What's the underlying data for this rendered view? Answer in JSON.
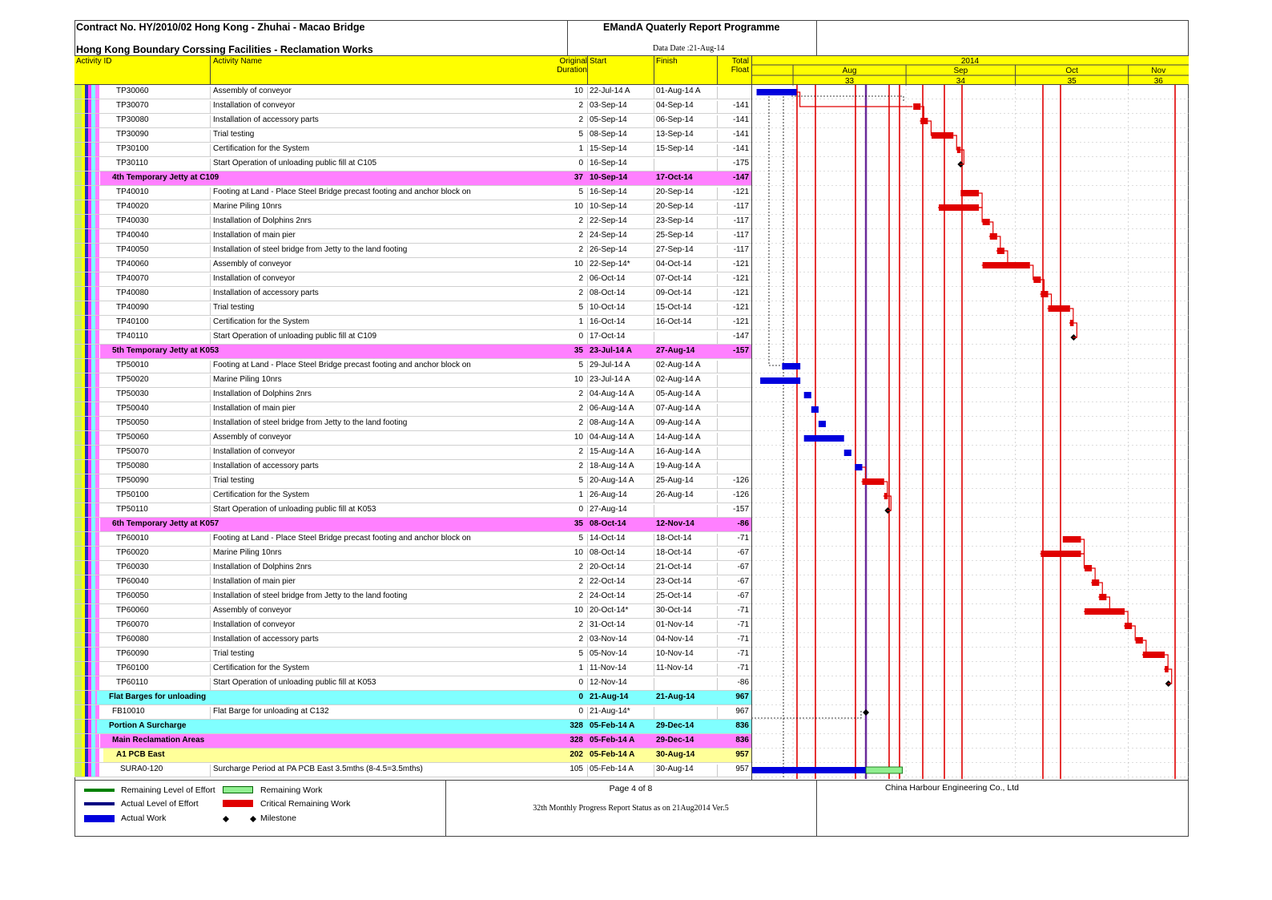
{
  "header": {
    "contract": "Contract No. HY/2010/02 Hong Kong - Zhuhai - Macao Bridge",
    "subtitle": "Hong Kong Boundary Corssing Facilities - Reclamation Works",
    "report_title": "EMandA Quaterly Report Programme",
    "data_date": "Data Date :21-Aug-14"
  },
  "columns": {
    "activity_id": "Activity ID",
    "activity_name": "Activity Name",
    "duration_1": "Original",
    "duration_2": "Duration",
    "start": "Start",
    "finish": "Finish",
    "float_1": "Total",
    "float_2": "Float"
  },
  "timescale": {
    "year": "2014",
    "months": [
      {
        "label": "Aug",
        "week": "33"
      },
      {
        "label": "Sep",
        "week": "34"
      },
      {
        "label": "Oct",
        "week": "35"
      },
      {
        "label": "Nov",
        "week": "36"
      }
    ]
  },
  "footer": {
    "page": "Page 4 of 8",
    "status": "32th Monthly Progress Report Status as on 21Aug2014 Ver.5",
    "company": "China Harbour Engineering Co., Ltd"
  },
  "legend": {
    "remaining_loe": "Remaining Level of Effort",
    "actual_loe": "Actual Level of Effort",
    "actual_work": "Actual Work",
    "remaining_work": "Remaining Work",
    "critical_remaining": "Critical Remaining Work",
    "milestone": "Milestone"
  },
  "colors": {
    "header_yellow": "#ffff00",
    "group_pink": "#ff80ff",
    "group_cyan": "#80ffff",
    "group_lightyellow": "#ffff99",
    "actual": "#0000dd",
    "critical": "#e00000",
    "remaining": "#90ee90",
    "loe_green": "#008000",
    "loe_navy": "#000080"
  },
  "chart_data": {
    "type": "gantt",
    "data_date": "21-Aug-14",
    "rows": [
      {
        "id": "TP30060",
        "name": "Assembly of conveyor",
        "dur": "10",
        "start": "22-Jul-14 A",
        "finish": "01-Aug-14 A",
        "float": "",
        "bar": "actual",
        "s": "2014-07-22",
        "f": "2014-08-01"
      },
      {
        "id": "TP30070",
        "name": "Installation of conveyor",
        "dur": "2",
        "start": "03-Sep-14",
        "finish": "04-Sep-14",
        "float": "-141",
        "bar": "critical",
        "s": "2014-09-03",
        "f": "2014-09-04"
      },
      {
        "id": "TP30080",
        "name": "Installation of accessory parts",
        "dur": "2",
        "start": "05-Sep-14",
        "finish": "06-Sep-14",
        "float": "-141",
        "bar": "critical",
        "s": "2014-09-05",
        "f": "2014-09-06"
      },
      {
        "id": "TP30090",
        "name": "Trial testing",
        "dur": "5",
        "start": "08-Sep-14",
        "finish": "13-Sep-14",
        "float": "-141",
        "bar": "critical",
        "s": "2014-09-08",
        "f": "2014-09-13"
      },
      {
        "id": "TP30100",
        "name": "Certification for the System",
        "dur": "1",
        "start": "15-Sep-14",
        "finish": "15-Sep-14",
        "float": "-141",
        "bar": "critical",
        "s": "2014-09-15",
        "f": "2014-09-15"
      },
      {
        "id": "TP30110",
        "name": "Start Operation of unloading public fill at C105",
        "dur": "0",
        "start": "16-Sep-14",
        "finish": "",
        "float": "-175",
        "bar": "milestone",
        "s": "2014-09-16",
        "f": "2014-09-16"
      },
      {
        "group": "pink",
        "name": "4th Temporary Jetty at C109",
        "dur": "37",
        "start": "10-Sep-14",
        "finish": "17-Oct-14",
        "float": "-147"
      },
      {
        "id": "TP40010",
        "name": "Footing at Land - Place Steel Bridge precast footing and anchor block on",
        "dur": "5",
        "start": "16-Sep-14",
        "finish": "20-Sep-14",
        "float": "-121",
        "bar": "critical",
        "s": "2014-09-16",
        "f": "2014-09-20"
      },
      {
        "id": "TP40020",
        "name": "Marine Piling 10nrs",
        "dur": "10",
        "start": "10-Sep-14",
        "finish": "20-Sep-14",
        "float": "-117",
        "bar": "critical",
        "s": "2014-09-10",
        "f": "2014-09-20"
      },
      {
        "id": "TP40030",
        "name": "Installation of Dolphins 2nrs",
        "dur": "2",
        "start": "22-Sep-14",
        "finish": "23-Sep-14",
        "float": "-117",
        "bar": "critical",
        "s": "2014-09-22",
        "f": "2014-09-23"
      },
      {
        "id": "TP40040",
        "name": "Installation of main pier",
        "dur": "2",
        "start": "24-Sep-14",
        "finish": "25-Sep-14",
        "float": "-117",
        "bar": "critical",
        "s": "2014-09-24",
        "f": "2014-09-25"
      },
      {
        "id": "TP40050",
        "name": "Installation of steel bridge from Jetty to the land footing",
        "dur": "2",
        "start": "26-Sep-14",
        "finish": "27-Sep-14",
        "float": "-117",
        "bar": "critical",
        "s": "2014-09-26",
        "f": "2014-09-27"
      },
      {
        "id": "TP40060",
        "name": "Assembly of conveyor",
        "dur": "10",
        "start": "22-Sep-14*",
        "finish": "04-Oct-14",
        "float": "-121",
        "bar": "critical",
        "s": "2014-09-22",
        "f": "2014-10-04"
      },
      {
        "id": "TP40070",
        "name": "Installation of conveyor",
        "dur": "2",
        "start": "06-Oct-14",
        "finish": "07-Oct-14",
        "float": "-121",
        "bar": "critical",
        "s": "2014-10-06",
        "f": "2014-10-07"
      },
      {
        "id": "TP40080",
        "name": "Installation of accessory parts",
        "dur": "2",
        "start": "08-Oct-14",
        "finish": "09-Oct-14",
        "float": "-121",
        "bar": "critical",
        "s": "2014-10-08",
        "f": "2014-10-09"
      },
      {
        "id": "TP40090",
        "name": "Trial testing",
        "dur": "5",
        "start": "10-Oct-14",
        "finish": "15-Oct-14",
        "float": "-121",
        "bar": "critical",
        "s": "2014-10-10",
        "f": "2014-10-15"
      },
      {
        "id": "TP40100",
        "name": "Certification for the System",
        "dur": "1",
        "start": "16-Oct-14",
        "finish": "16-Oct-14",
        "float": "-121",
        "bar": "critical",
        "s": "2014-10-16",
        "f": "2014-10-16"
      },
      {
        "id": "TP40110",
        "name": "Start Operation of unloading public fill at C109",
        "dur": "0",
        "start": "17-Oct-14",
        "finish": "",
        "float": "-147",
        "bar": "milestone",
        "s": "2014-10-17",
        "f": "2014-10-17"
      },
      {
        "group": "pink",
        "name": "5th Temporary Jetty at K053",
        "dur": "35",
        "start": "23-Jul-14 A",
        "finish": "27-Aug-14",
        "float": "-157"
      },
      {
        "id": "TP50010",
        "name": "Footing at Land - Place Steel Bridge precast footing and anchor block on",
        "dur": "5",
        "start": "29-Jul-14 A",
        "finish": "02-Aug-14 A",
        "float": "",
        "bar": "actual",
        "s": "2014-07-29",
        "f": "2014-08-02"
      },
      {
        "id": "TP50020",
        "name": "Marine Piling 10nrs",
        "dur": "10",
        "start": "23-Jul-14 A",
        "finish": "02-Aug-14 A",
        "float": "",
        "bar": "actual",
        "s": "2014-07-23",
        "f": "2014-08-02"
      },
      {
        "id": "TP50030",
        "name": "Installation of Dolphins 2nrs",
        "dur": "2",
        "start": "04-Aug-14 A",
        "finish": "05-Aug-14 A",
        "float": "",
        "bar": "actual",
        "s": "2014-08-04",
        "f": "2014-08-05"
      },
      {
        "id": "TP50040",
        "name": "Installation of main pier",
        "dur": "2",
        "start": "06-Aug-14 A",
        "finish": "07-Aug-14 A",
        "float": "",
        "bar": "actual",
        "s": "2014-08-06",
        "f": "2014-08-07"
      },
      {
        "id": "TP50050",
        "name": "Installation of steel bridge from Jetty to the land footing",
        "dur": "2",
        "start": "08-Aug-14 A",
        "finish": "09-Aug-14 A",
        "float": "",
        "bar": "actual",
        "s": "2014-08-08",
        "f": "2014-08-09"
      },
      {
        "id": "TP50060",
        "name": "Assembly of conveyor",
        "dur": "10",
        "start": "04-Aug-14 A",
        "finish": "14-Aug-14 A",
        "float": "",
        "bar": "actual",
        "s": "2014-08-04",
        "f": "2014-08-14"
      },
      {
        "id": "TP50070",
        "name": "Installation of conveyor",
        "dur": "2",
        "start": "15-Aug-14 A",
        "finish": "16-Aug-14 A",
        "float": "",
        "bar": "actual",
        "s": "2014-08-15",
        "f": "2014-08-16"
      },
      {
        "id": "TP50080",
        "name": "Installation of accessory parts",
        "dur": "2",
        "start": "18-Aug-14 A",
        "finish": "19-Aug-14 A",
        "float": "",
        "bar": "actual",
        "s": "2014-08-18",
        "f": "2014-08-19"
      },
      {
        "id": "TP50090",
        "name": "Trial testing",
        "dur": "5",
        "start": "20-Aug-14 A",
        "finish": "25-Aug-14",
        "float": "-126",
        "bar": "critical",
        "s": "2014-08-20",
        "f": "2014-08-25"
      },
      {
        "id": "TP50100",
        "name": "Certification for the System",
        "dur": "1",
        "start": "26-Aug-14",
        "finish": "26-Aug-14",
        "float": "-126",
        "bar": "critical",
        "s": "2014-08-26",
        "f": "2014-08-26"
      },
      {
        "id": "TP50110",
        "name": "Start Operation of unloading public fill at K053",
        "dur": "0",
        "start": "27-Aug-14",
        "finish": "",
        "float": "-157",
        "bar": "milestone",
        "s": "2014-08-27",
        "f": "2014-08-27"
      },
      {
        "group": "pink",
        "name": "6th Temporary Jetty at K057",
        "dur": "35",
        "start": "08-Oct-14",
        "finish": "12-Nov-14",
        "float": "-86"
      },
      {
        "id": "TP60010",
        "name": "Footing at Land - Place Steel Bridge precast footing and anchor block on",
        "dur": "5",
        "start": "14-Oct-14",
        "finish": "18-Oct-14",
        "float": "-71",
        "bar": "critical",
        "s": "2014-10-14",
        "f": "2014-10-18"
      },
      {
        "id": "TP60020",
        "name": "Marine Piling 10nrs",
        "dur": "10",
        "start": "08-Oct-14",
        "finish": "18-Oct-14",
        "float": "-67",
        "bar": "critical",
        "s": "2014-10-08",
        "f": "2014-10-18"
      },
      {
        "id": "TP60030",
        "name": "Installation of Dolphins 2nrs",
        "dur": "2",
        "start": "20-Oct-14",
        "finish": "21-Oct-14",
        "float": "-67",
        "bar": "critical",
        "s": "2014-10-20",
        "f": "2014-10-21"
      },
      {
        "id": "TP60040",
        "name": "Installation of main pier",
        "dur": "2",
        "start": "22-Oct-14",
        "finish": "23-Oct-14",
        "float": "-67",
        "bar": "critical",
        "s": "2014-10-22",
        "f": "2014-10-23"
      },
      {
        "id": "TP60050",
        "name": "Installation of steel bridge from Jetty to the land footing",
        "dur": "2",
        "start": "24-Oct-14",
        "finish": "25-Oct-14",
        "float": "-67",
        "bar": "critical",
        "s": "2014-10-24",
        "f": "2014-10-25"
      },
      {
        "id": "TP60060",
        "name": "Assembly of conveyor",
        "dur": "10",
        "start": "20-Oct-14*",
        "finish": "30-Oct-14",
        "float": "-71",
        "bar": "critical",
        "s": "2014-10-20",
        "f": "2014-10-30"
      },
      {
        "id": "TP60070",
        "name": "Installation of conveyor",
        "dur": "2",
        "start": "31-Oct-14",
        "finish": "01-Nov-14",
        "float": "-71",
        "bar": "critical",
        "s": "2014-10-31",
        "f": "2014-11-01"
      },
      {
        "id": "TP60080",
        "name": "Installation of accessory parts",
        "dur": "2",
        "start": "03-Nov-14",
        "finish": "04-Nov-14",
        "float": "-71",
        "bar": "critical",
        "s": "2014-11-03",
        "f": "2014-11-04"
      },
      {
        "id": "TP60090",
        "name": "Trial testing",
        "dur": "5",
        "start": "05-Nov-14",
        "finish": "10-Nov-14",
        "float": "-71",
        "bar": "critical",
        "s": "2014-11-05",
        "f": "2014-11-10"
      },
      {
        "id": "TP60100",
        "name": "Certification for the System",
        "dur": "1",
        "start": "11-Nov-14",
        "finish": "11-Nov-14",
        "float": "-71",
        "bar": "critical",
        "s": "2014-11-11",
        "f": "2014-11-11"
      },
      {
        "id": "TP60110",
        "name": "Start Operation of unloading public fill at K053",
        "dur": "0",
        "start": "12-Nov-14",
        "finish": "",
        "float": "-86",
        "bar": "milestone",
        "s": "2014-11-12",
        "f": "2014-11-12"
      },
      {
        "group": "cyan",
        "name": "Flat Barges for unloading",
        "dur": "0",
        "start": "21-Aug-14",
        "finish": "21-Aug-14",
        "float": "967"
      },
      {
        "id": "FB10010",
        "name": "Flat Barge for unloading at C132",
        "dur": "0",
        "start": "21-Aug-14*",
        "finish": "",
        "float": "967",
        "bar": "milestone",
        "s": "2014-08-21",
        "f": "2014-08-21"
      },
      {
        "group": "cyan",
        "name": "Portion A Surcharge",
        "dur": "328",
        "start": "05-Feb-14 A",
        "finish": "29-Dec-14",
        "float": "836"
      },
      {
        "group": "pink",
        "name": "Main Reclamation Areas",
        "dur": "328",
        "start": "05-Feb-14 A",
        "finish": "29-Dec-14",
        "float": "836"
      },
      {
        "group": "lightyellow",
        "name": "A1 PCB East",
        "dur": "202",
        "start": "05-Feb-14 A",
        "finish": "30-Aug-14",
        "float": "957"
      },
      {
        "id": "SURA0-120",
        "name": "Surcharge Period at PA PCB East 3.5mths (8-4.5=3.5mths)",
        "dur": "105",
        "start": "05-Feb-14 A",
        "finish": "30-Aug-14",
        "float": "957",
        "bar": "actual_remaining",
        "s": "2014-02-05",
        "f": "2014-08-30"
      }
    ]
  }
}
